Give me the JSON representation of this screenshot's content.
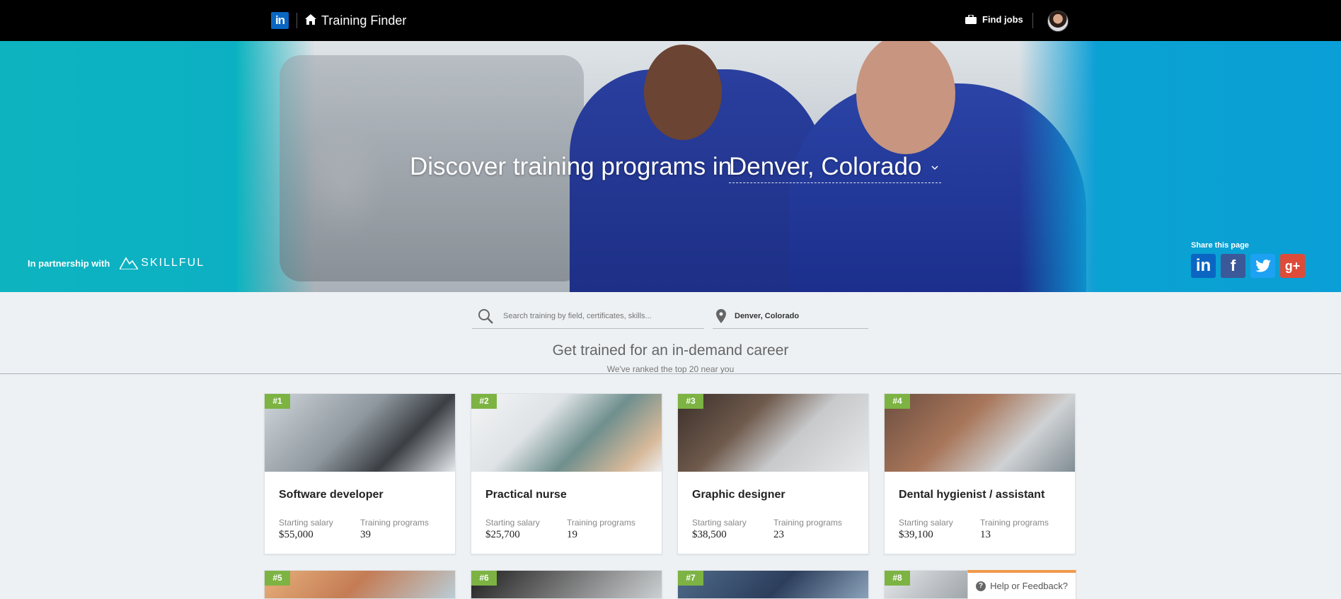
{
  "header": {
    "logo_text": "in",
    "title": "Training Finder",
    "find_jobs": "Find jobs"
  },
  "hero": {
    "heading_prefix": "Discover training programs in",
    "location": "Denver, Colorado",
    "partner_label": "In partnership with",
    "partner_name": "SKILLFUL",
    "share_label": "Share this page",
    "share_buttons": [
      "in",
      "f",
      "t",
      "g+"
    ]
  },
  "search": {
    "placeholder": "Search training by field, certificates, skills...",
    "location_value": "Denver, Colorado"
  },
  "section": {
    "title": "Get trained for an in-demand career",
    "subtitle": "We've ranked the top 20 near you"
  },
  "careers": [
    {
      "rank": "#1",
      "title": "Software developer",
      "salary_label": "Starting salary",
      "salary": "$55,000",
      "programs_label": "Training programs",
      "programs": "39"
    },
    {
      "rank": "#2",
      "title": "Practical nurse",
      "salary_label": "Starting salary",
      "salary": "$25,700",
      "programs_label": "Training programs",
      "programs": "19"
    },
    {
      "rank": "#3",
      "title": "Graphic designer",
      "salary_label": "Starting salary",
      "salary": "$38,500",
      "programs_label": "Training programs",
      "programs": "23"
    },
    {
      "rank": "#4",
      "title": "Dental hygienist / assistant",
      "salary_label": "Starting salary",
      "salary": "$39,100",
      "programs_label": "Training programs",
      "programs": "13"
    },
    {
      "rank": "#5"
    },
    {
      "rank": "#6"
    },
    {
      "rank": "#7"
    },
    {
      "rank": "#8"
    }
  ],
  "help": {
    "label": "Help or Feedback?"
  }
}
